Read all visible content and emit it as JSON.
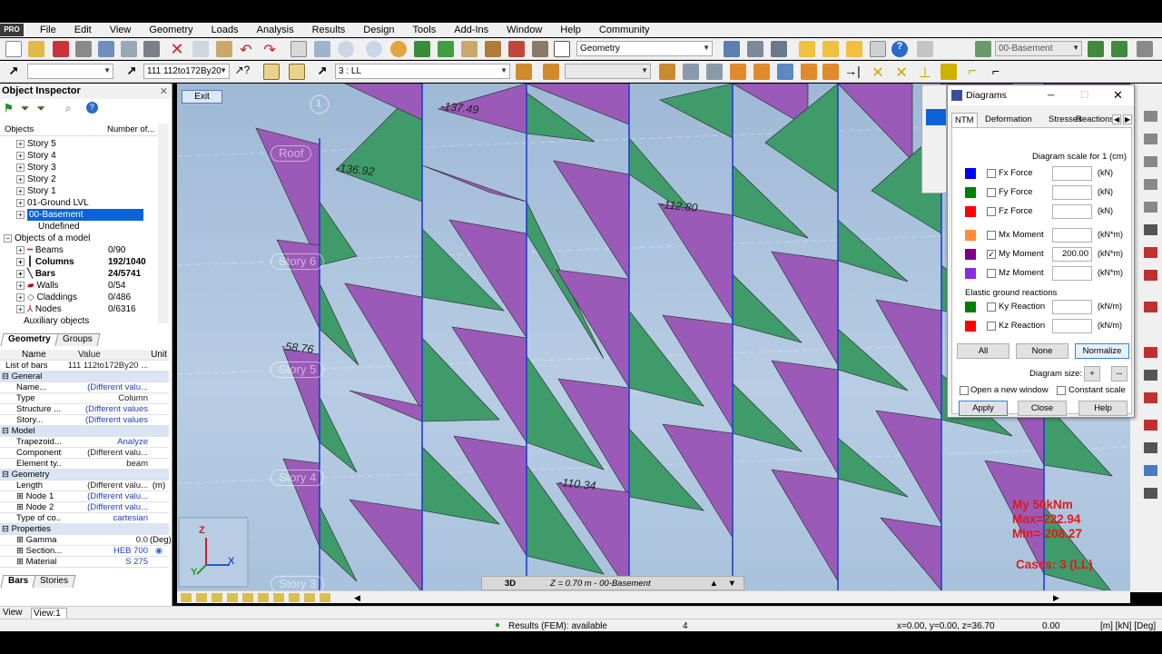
{
  "menu": [
    "File",
    "Edit",
    "View",
    "Geometry",
    "Loads",
    "Analysis",
    "Results",
    "Design",
    "Tools",
    "Add-Ins",
    "Window",
    "Help",
    "Community"
  ],
  "toolbar": {
    "geometry_combo": "Geometry",
    "story_combo": "00-Basement",
    "section_combo": "111 112to172By20",
    "case_combo": "3 : LL"
  },
  "object_inspector": {
    "title": "Object Inspector",
    "col_objects": "Objects",
    "col_number": "Number of...",
    "stories": [
      "Story 5",
      "Story 4",
      "Story 3",
      "Story 2",
      "Story 1",
      "01-Ground LVL",
      "00-Basement",
      "Undefined"
    ],
    "objects_of_model": "Objects of a model",
    "items": [
      {
        "name": "Beams",
        "count": "0/90",
        "bold": false
      },
      {
        "name": "Columns",
        "count": "192/1040",
        "bold": true
      },
      {
        "name": "Bars",
        "count": "24/5741",
        "bold": true
      },
      {
        "name": "Walls",
        "count": "0/54",
        "bold": false
      },
      {
        "name": "Claddings",
        "count": "0/486",
        "bold": false
      },
      {
        "name": "Nodes",
        "count": "0/6316",
        "bold": false
      }
    ],
    "auxiliary": "Auxiliary objects",
    "tab_geometry": "Geometry",
    "tab_groups": "Groups",
    "tab_bars": "Bars",
    "tab_stories": "Stories"
  },
  "properties": {
    "h_name": "Name",
    "h_value": "Value",
    "h_unit": "Unit",
    "list_label": "List of bars",
    "list_value": "111 112to172By20 ...",
    "rows": [
      {
        "type": "grp",
        "name": "General"
      },
      {
        "name": "Name...",
        "value": "(Different valu...",
        "blue": true
      },
      {
        "name": "Type",
        "value": "Column"
      },
      {
        "name": "Structure ...",
        "value": "(Different values",
        "blue": true
      },
      {
        "name": "Story...",
        "value": "(Different values",
        "blue": true
      },
      {
        "type": "grp",
        "name": "Model"
      },
      {
        "name": "Trapezoid...",
        "value": "Analyze",
        "blue": true
      },
      {
        "name": "Components",
        "value": "(Different valu..."
      },
      {
        "name": "Element ty...",
        "value": "beam"
      },
      {
        "type": "grp",
        "name": "Geometry"
      },
      {
        "name": "Length",
        "value": "(Different valu...",
        "unit": "(m)"
      },
      {
        "name": "Node 1",
        "value": "(Different valu...",
        "blue": true
      },
      {
        "name": "Node 2",
        "value": "(Different valu...",
        "blue": true
      },
      {
        "name": "Type of co...",
        "value": "cartesian",
        "blue": true
      },
      {
        "type": "grp",
        "name": "Properties"
      },
      {
        "name": "Gamma",
        "value": "0.0",
        "unit": "(Deg)"
      },
      {
        "name": "Section...",
        "value": "HEB 700",
        "blue": true
      },
      {
        "name": "Material",
        "value": "S 275",
        "blue": true
      }
    ]
  },
  "viewport": {
    "exit": "Exit",
    "axis_label": "1",
    "stories": [
      "Roof",
      "Story 6",
      "Story 5",
      "Story 4",
      "Story 3"
    ],
    "values": [
      "-137.49",
      "-136.92",
      "-112.80",
      "-58.76",
      "-110.34"
    ],
    "legend": [
      "My  50kNm",
      "Max=222.94",
      "Min=-208.27",
      "Cases: 3 (LL)"
    ],
    "view_mode": "3D",
    "plane": "Z = 0.70 m - 00-Basement"
  },
  "diagrams": {
    "title": "Diagrams",
    "tabs": [
      "NTM",
      "Deformation",
      "Stresses",
      "Reactions"
    ],
    "scale_label": "Diagram scale for 1  (cm)",
    "forces": [
      {
        "color": "#0000ff",
        "label": "Fx Force",
        "value": "",
        "unit": "(kN)",
        "checked": false
      },
      {
        "color": "#008000",
        "label": "Fy Force",
        "value": "",
        "unit": "(kN)",
        "checked": false
      },
      {
        "color": "#ff0000",
        "label": "Fz Force",
        "value": "",
        "unit": "(kN)",
        "checked": false
      },
      {
        "color": "#ff8c3a",
        "label": "Mx Moment",
        "value": "",
        "unit": "(kN*m)",
        "checked": false
      },
      {
        "color": "#7b0085",
        "label": "My Moment",
        "value": "200.00",
        "unit": "(kN*m)",
        "checked": true
      },
      {
        "color": "#8a2be2",
        "label": "Mz Moment",
        "value": "",
        "unit": "(kN*m)",
        "checked": false
      }
    ],
    "elastic_label": "Elastic ground reactions",
    "reactions": [
      {
        "color": "#008000",
        "label": "Ky Reaction",
        "value": "",
        "unit": "(kN/m)",
        "checked": false
      },
      {
        "color": "#ff0000",
        "label": "Kz Reaction",
        "value": "",
        "unit": "(kN/m)",
        "checked": false
      }
    ],
    "btn_all": "All",
    "btn_none": "None",
    "btn_normalize": "Normalize",
    "size_label": "Diagram size:",
    "open_new": "Open a new window",
    "constant_scale": "Constant scale",
    "btn_apply": "Apply",
    "btn_close": "Close",
    "btn_help": "Help"
  },
  "status": {
    "view": "View",
    "view1": "View:1",
    "results": "Results (FEM): available",
    "num": "4",
    "coords": "x=0.00, y=0.00, z=36.70",
    "val": "0.00",
    "units": "[m] [kN] [Deg]"
  }
}
